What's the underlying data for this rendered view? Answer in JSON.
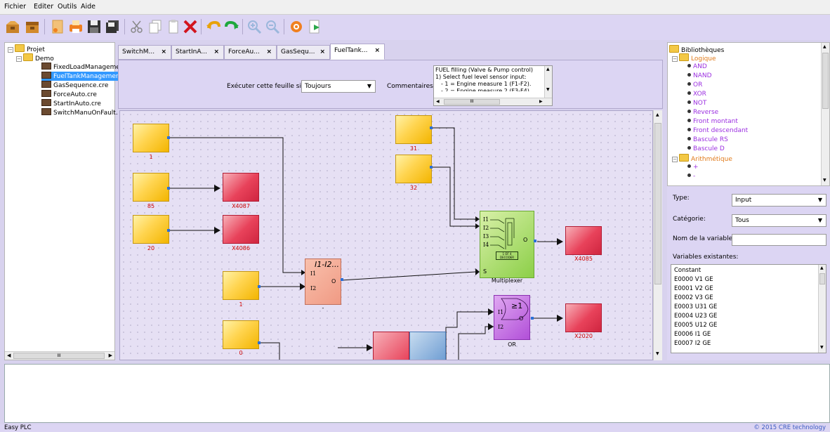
{
  "menu": [
    "Fichier",
    "Editer",
    "Outils",
    "Aide"
  ],
  "toolbar": {
    "icons": [
      "open-project-icon",
      "close-project-icon",
      "new-file-icon",
      "print-icon",
      "save-icon",
      "save-all-icon",
      "cut-icon",
      "copy-icon",
      "paste-icon",
      "delete-icon",
      "undo-icon",
      "redo-icon",
      "zoom-in-icon",
      "zoom-out-icon",
      "compile-icon",
      "export-icon"
    ]
  },
  "project": {
    "root": "Projet",
    "folder": "Demo",
    "files": [
      "FixedLoadManageme",
      "FuelTankManagemer",
      "GasSequence.cre",
      "ForceAuto.cre",
      "StartInAuto.cre",
      "SwitchManuOnFault."
    ],
    "scroll_label": "III"
  },
  "tabs": [
    "SwitchM...",
    "StartInA...",
    "ForceAu...",
    "GasSequ...",
    "FuelTank..."
  ],
  "tab_close": "×",
  "sheet": {
    "execute_label": "Exécuter cette feuille si:",
    "execute_value": "Toujours",
    "comments_label": "Commentaires:",
    "comments_lines": [
      "FUEL filling (Valve & Pump control)",
      "1) Select fuel level sensor input:",
      "- 1 = Engine measure 1 (F1-F2).",
      "- 2 = Engine measure 2 (F3-F4)."
    ],
    "scroll_label": "III"
  },
  "canvas": {
    "yellow_labels": [
      "1",
      "85",
      "20",
      "1",
      "0",
      "31",
      "32"
    ],
    "red_labels": [
      "X4087",
      "X4086",
      "X4085",
      "X2020"
    ],
    "sub_block": {
      "title": "I1-I2...",
      "in1": "I1",
      "in2": "I2",
      "out": "O",
      "footer": "-"
    },
    "mux_block": {
      "inputs": [
        "I1",
        "I2",
        "I3",
        "I4"
      ],
      "select": "S",
      "out": "O",
      "inner": "1 OF 4 DECODER",
      "name": "Multiplexer"
    },
    "or_block": {
      "symbol": "≥1",
      "in1": "I1",
      "in2": "I2",
      "out": "O",
      "name": "OR"
    }
  },
  "library": {
    "root": "Bibliothèques",
    "cat1": "Logique",
    "logic_items": [
      "AND",
      "NAND",
      "OR",
      "XOR",
      "NOT",
      "Reverse",
      "Front montant",
      "Front descendant",
      "Bascule RS",
      "Bascule D"
    ],
    "cat2": "Arithmétique",
    "arith_items": [
      "+",
      "-"
    ]
  },
  "props": {
    "type_label": "Type:",
    "type_value": "Input",
    "cat_label": "Catégorie:",
    "cat_value": "Tous",
    "varname_label": "Nom de la variable:",
    "varname_value": "",
    "existing_label": "Variables existantes:",
    "vars": [
      "Constant",
      "E0000 V1 GE",
      "E0001 V2 GE",
      "E0002 V3 GE",
      "E0003 U31 GE",
      "E0004 U23 GE",
      "E0005 U12 GE",
      "E0006 I1 GE",
      "E0007 I2 GE"
    ]
  },
  "status": {
    "app": "Easy PLC",
    "copyright": "© 2015 CRE technology"
  },
  "colors": {
    "accent": "#dcd5f3",
    "library_item": "#9b2fe0",
    "category": "#e07a1a",
    "label_red": "#cc0000"
  }
}
